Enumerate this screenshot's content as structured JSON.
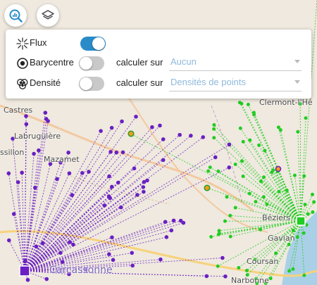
{
  "map": {
    "places": [
      "Castres",
      "Labruguière",
      "Mazamet",
      "Béziers",
      "Clermont-l'Hé",
      "Gavian",
      "Coursan",
      "Narbonne",
      "Carcassonne"
    ],
    "partial_labels": [
      "ssillon"
    ],
    "colors": {
      "purple": "#6a1fc2",
      "green": "#22cc22",
      "orange": "#f29c1f",
      "land": "#efe9df",
      "sea": "#a9d0e6"
    }
  },
  "toolbar": {
    "analysis_icon": "chart-analysis-icon",
    "layers_icon": "layers-icon",
    "accent": "#2a8bc9"
  },
  "panel": {
    "flux": {
      "label": "Flux",
      "icon": "flux-icon",
      "enabled": true
    },
    "barycentre": {
      "label": "Barycentre",
      "icon": "target-icon",
      "enabled": false,
      "calc_label": "calculer sur",
      "value": "Aucun"
    },
    "densite": {
      "label": "Densité",
      "icon": "density-icon",
      "enabled": false,
      "calc_label": "calculer sur",
      "value": "Densités de points"
    }
  }
}
